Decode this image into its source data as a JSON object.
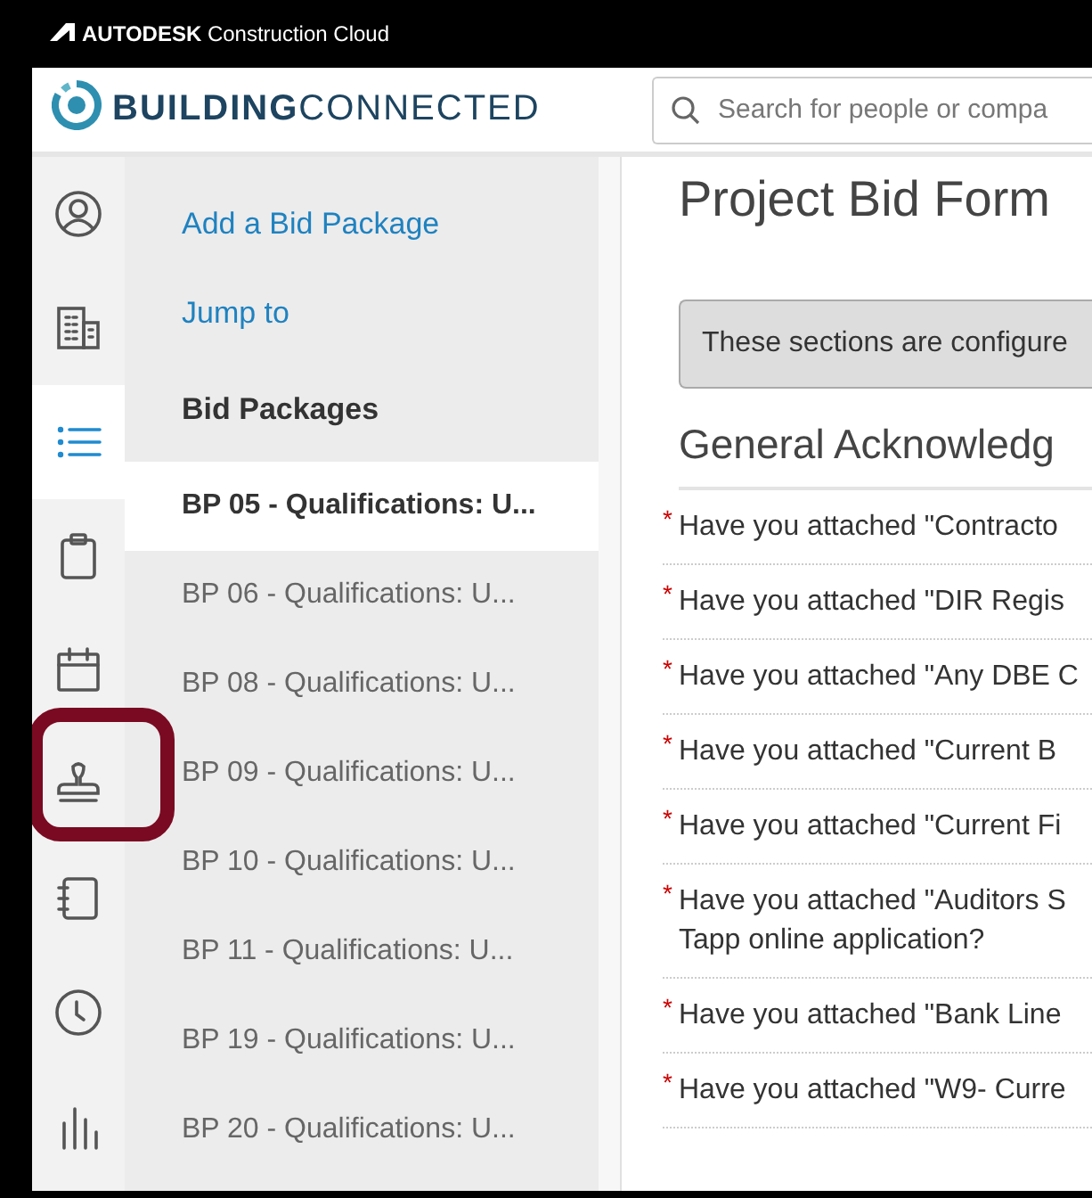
{
  "window": {
    "title": "**AUTODESK** Construction Cloud"
  },
  "header": {
    "logo": "**BUILDING**CONNECTED",
    "search": {
      "placeholder": "Search for people or compa"
    }
  },
  "nav_rail": [
    {
      "kind": "user",
      "selected": false
    },
    {
      "kind": "building",
      "selected": false
    },
    {
      "kind": "list",
      "selected": true
    },
    {
      "kind": "clipboard",
      "selected": false
    },
    {
      "kind": "calendar",
      "selected": false
    },
    {
      "kind": "stamp",
      "selected": false,
      "highlighted": true
    },
    {
      "kind": "notebook",
      "selected": false
    },
    {
      "kind": "clock",
      "selected": false
    },
    {
      "kind": "chart",
      "selected": false
    }
  ],
  "side_panel": {
    "links": [
      "Add a Bid Package",
      "Jump to"
    ],
    "heading": "Bid Packages",
    "packages": [
      {
        "label": "BP 05 - Qualifications: U...",
        "selected": true
      },
      {
        "label": "BP 06 - Qualifications: U...",
        "selected": false
      },
      {
        "label": "BP 08 - Qualifications: U...",
        "selected": false
      },
      {
        "label": "BP 09 - Qualifications: U...",
        "selected": false
      },
      {
        "label": "BP 10 - Qualifications: U...",
        "selected": false
      },
      {
        "label": "BP 11 - Qualifications: U...",
        "selected": false
      },
      {
        "label": "BP 19 - Qualifications: U...",
        "selected": false
      },
      {
        "label": "BP 20 - Qualifications: U...",
        "selected": false
      }
    ]
  },
  "main": {
    "title": "Project Bid Form",
    "notice": "These sections are configure",
    "section_title": "General Acknowledg",
    "questions": [
      {
        "text": "Have you attached \"Contracto",
        "required_mark": "*"
      },
      {
        "text": "Have you attached \"DIR Regis",
        "required_mark": "*"
      },
      {
        "text": "Have you attached \"Any DBE C",
        "required_mark": "*"
      },
      {
        "text": "Have you attached \"Current B",
        "required_mark": "*"
      },
      {
        "text": "Have you attached \"Current Fi",
        "required_mark": "*"
      },
      {
        "text": "Have you attached \"Auditors S",
        "continuation": "Tapp online application?",
        "required_mark": "*"
      },
      {
        "text": "Have you attached \"Bank Line",
        "required_mark": "*"
      },
      {
        "text": "Have you attached \"W9- Curre",
        "required_mark": "*"
      }
    ]
  }
}
